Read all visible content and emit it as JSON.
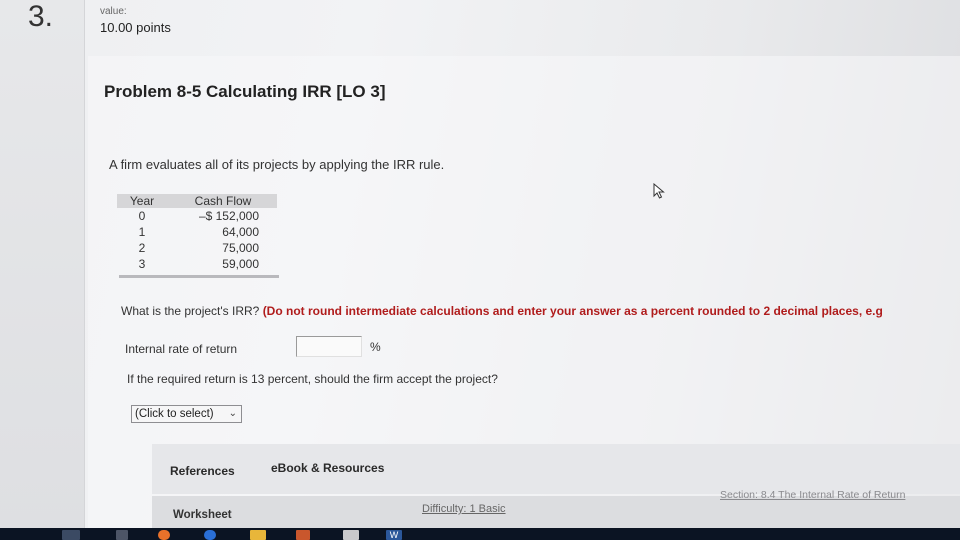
{
  "question": {
    "number": "3.",
    "value_label": "value:",
    "points": "10.00 points"
  },
  "problem": {
    "title": "Problem 8-5 Calculating IRR [LO 3]",
    "intro": "A firm evaluates all of its projects by applying the IRR rule."
  },
  "cash_flow_table": {
    "headers": [
      "Year",
      "Cash Flow"
    ],
    "rows": [
      [
        "0",
        "–$ 152,000"
      ],
      [
        "1",
        "64,000"
      ],
      [
        "2",
        "75,000"
      ],
      [
        "3",
        "59,000"
      ]
    ]
  },
  "irr_question": {
    "prefix": "What is the project's IRR?",
    "instruction": "(Do not round intermediate calculations and enter your answer as a percent rounded to 2 decimal places, e.g"
  },
  "irr_field": {
    "label": "Internal rate of return",
    "value": "",
    "unit": "%"
  },
  "accept_question": {
    "text": "If the required return is 13 percent, should the firm accept the project?",
    "select_value": "(Click to select)"
  },
  "tabs": {
    "references": "References",
    "ebook": "eBook & Resources"
  },
  "footer": {
    "worksheet": "Worksheet",
    "difficulty": "Difficulty: 1 Basic",
    "section": "Section: 8.4 The Internal Rate of Return"
  },
  "taskbar": {
    "word_label": "W"
  },
  "colors": {
    "instruction_red": "#b01c1c",
    "taskbar": "#0b1423"
  }
}
